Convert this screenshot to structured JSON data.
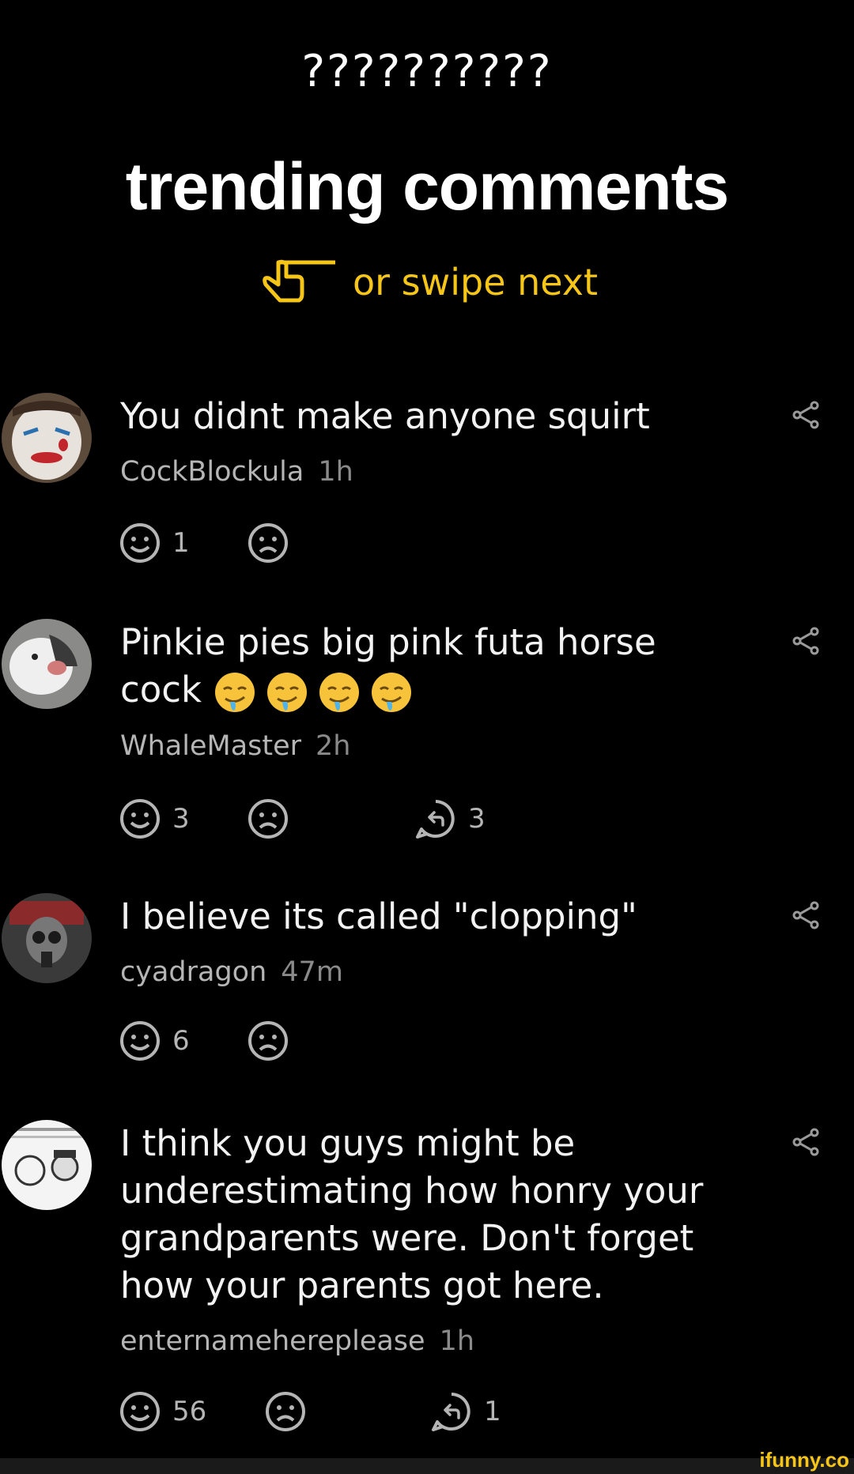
{
  "header": {
    "title": "??????????",
    "heading": "trending comments",
    "swipe_hint": "or swipe next",
    "accent_color": "#f5c518"
  },
  "comments": [
    {
      "text": "You didnt make anyone squirt",
      "user": "CockBlockula",
      "time": "1h",
      "likes": "1",
      "replies": ""
    },
    {
      "text": "Pinkie pies big pink futa horse cock",
      "user": "WhaleMaster",
      "time": "2h",
      "likes": "3",
      "replies": "3"
    },
    {
      "text": "I believe its called \"clopping\"",
      "user": "cyadragon",
      "time": "47m",
      "likes": "6",
      "replies": ""
    },
    {
      "text": "I think you guys might be underestimating how honry your grandparents were. Don't forget how your parents got here.",
      "user": "enternamehereplease",
      "time": "1h",
      "likes": "56",
      "replies": "1"
    }
  ],
  "footer": {
    "brand": "ifunny.co"
  }
}
